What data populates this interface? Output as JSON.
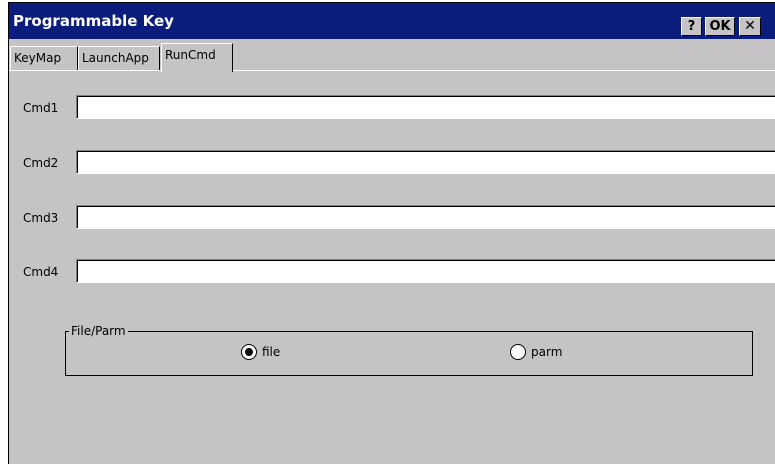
{
  "window": {
    "title": "Programmable Key",
    "help_label": "?",
    "ok_label": "OK",
    "close_label": "✕"
  },
  "tabs": [
    {
      "label": "KeyMap",
      "active": false
    },
    {
      "label": "LaunchApp",
      "active": false
    },
    {
      "label": "RunCmd",
      "active": true
    }
  ],
  "commands": [
    {
      "label": "Cmd1",
      "value": ""
    },
    {
      "label": "Cmd2",
      "value": ""
    },
    {
      "label": "Cmd3",
      "value": ""
    },
    {
      "label": "Cmd4",
      "value": ""
    }
  ],
  "file_parm": {
    "group_label": "File/Parm",
    "options": [
      {
        "label": "file",
        "selected": true
      },
      {
        "label": "parm",
        "selected": false
      }
    ]
  }
}
